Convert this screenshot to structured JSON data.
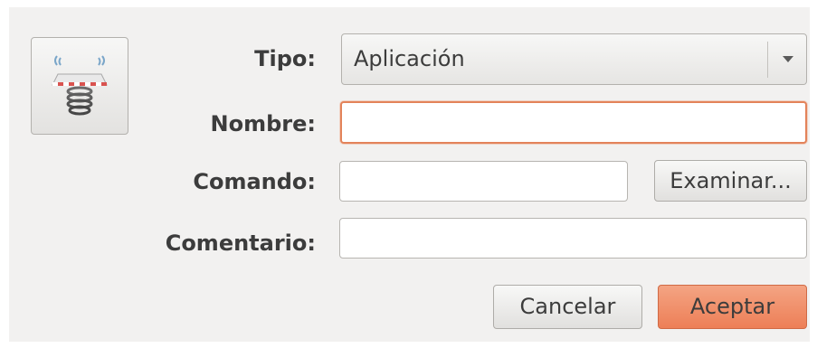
{
  "form": {
    "type_label": "Tipo:",
    "type_value": "Aplicación",
    "name_label": "Nombre:",
    "name_value": "",
    "command_label": "Comando:",
    "command_value": "",
    "browse_label": "Examinar...",
    "comment_label": "Comentario:",
    "comment_value": ""
  },
  "actions": {
    "cancel_label": "Cancelar",
    "accept_label": "Aceptar"
  },
  "launcher_icon": "spring-launcher-icon",
  "colors": {
    "accent": "#ed7f57",
    "focus_border": "#e3835a",
    "background": "#f2f1f0"
  }
}
